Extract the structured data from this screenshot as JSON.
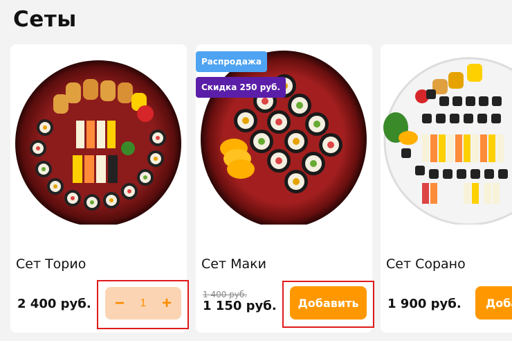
{
  "page": {
    "title": "Сеты"
  },
  "products": [
    {
      "name": "Сет Торио",
      "price": "2 400 руб.",
      "quantity": "1",
      "minus_symbol": "−",
      "plus_symbol": "+"
    },
    {
      "name": "Сет Маки",
      "old_price": "1 400 руб.",
      "price": "1 150 руб.",
      "add_label": "Добавить",
      "badges": [
        "Распродажа",
        "Скидка 250 руб."
      ]
    },
    {
      "name": "Сет Сорано",
      "price": "1 900 руб.",
      "add_label": "Доба"
    }
  ],
  "colors": {
    "accent": "#ff9800",
    "stepper_bg": "#fbd5b3",
    "badge_sale": "#4ea3f2",
    "badge_discount": "#5b1ea8",
    "highlight": "#e01a1a"
  }
}
